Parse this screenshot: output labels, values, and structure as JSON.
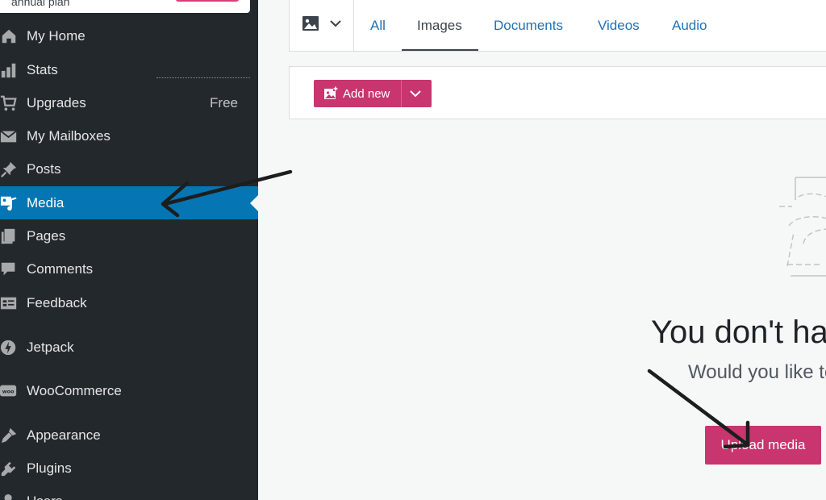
{
  "plan": {
    "label": "annual plan"
  },
  "sidebar": {
    "items": [
      {
        "label": "My Home",
        "icon": "home-icon"
      },
      {
        "label": "Stats",
        "icon": "stats-icon"
      },
      {
        "label": "Upgrades",
        "icon": "cart-icon",
        "badge": "Free"
      },
      {
        "label": "My Mailboxes",
        "icon": "mail-icon"
      },
      {
        "label": "Posts",
        "icon": "pin-icon"
      },
      {
        "label": "Media",
        "icon": "media-icon",
        "active": true
      },
      {
        "label": "Pages",
        "icon": "pages-icon"
      },
      {
        "label": "Comments",
        "icon": "comment-icon"
      },
      {
        "label": "Feedback",
        "icon": "feedback-icon"
      },
      {
        "label": "Jetpack",
        "icon": "jetpack-icon"
      },
      {
        "label": "WooCommerce",
        "icon": "woo-icon"
      },
      {
        "label": "Appearance",
        "icon": "brush-icon"
      },
      {
        "label": "Plugins",
        "icon": "plugin-icon"
      },
      {
        "label": "Users",
        "icon": "users-icon"
      }
    ]
  },
  "filter": {
    "tabs": [
      {
        "label": "All"
      },
      {
        "label": "Images",
        "selected": true
      },
      {
        "label": "Documents"
      },
      {
        "label": "Videos"
      },
      {
        "label": "Audio"
      }
    ]
  },
  "toolbar": {
    "add_new_label": "Add new"
  },
  "empty": {
    "title": "You don't ha",
    "subtitle": "Would you like to",
    "upload_label": "Upload media"
  },
  "colors": {
    "accent": "#c9356e",
    "active_nav": "#0675b3",
    "sidebar_bg": "#23282d",
    "link": "#2271b1"
  }
}
